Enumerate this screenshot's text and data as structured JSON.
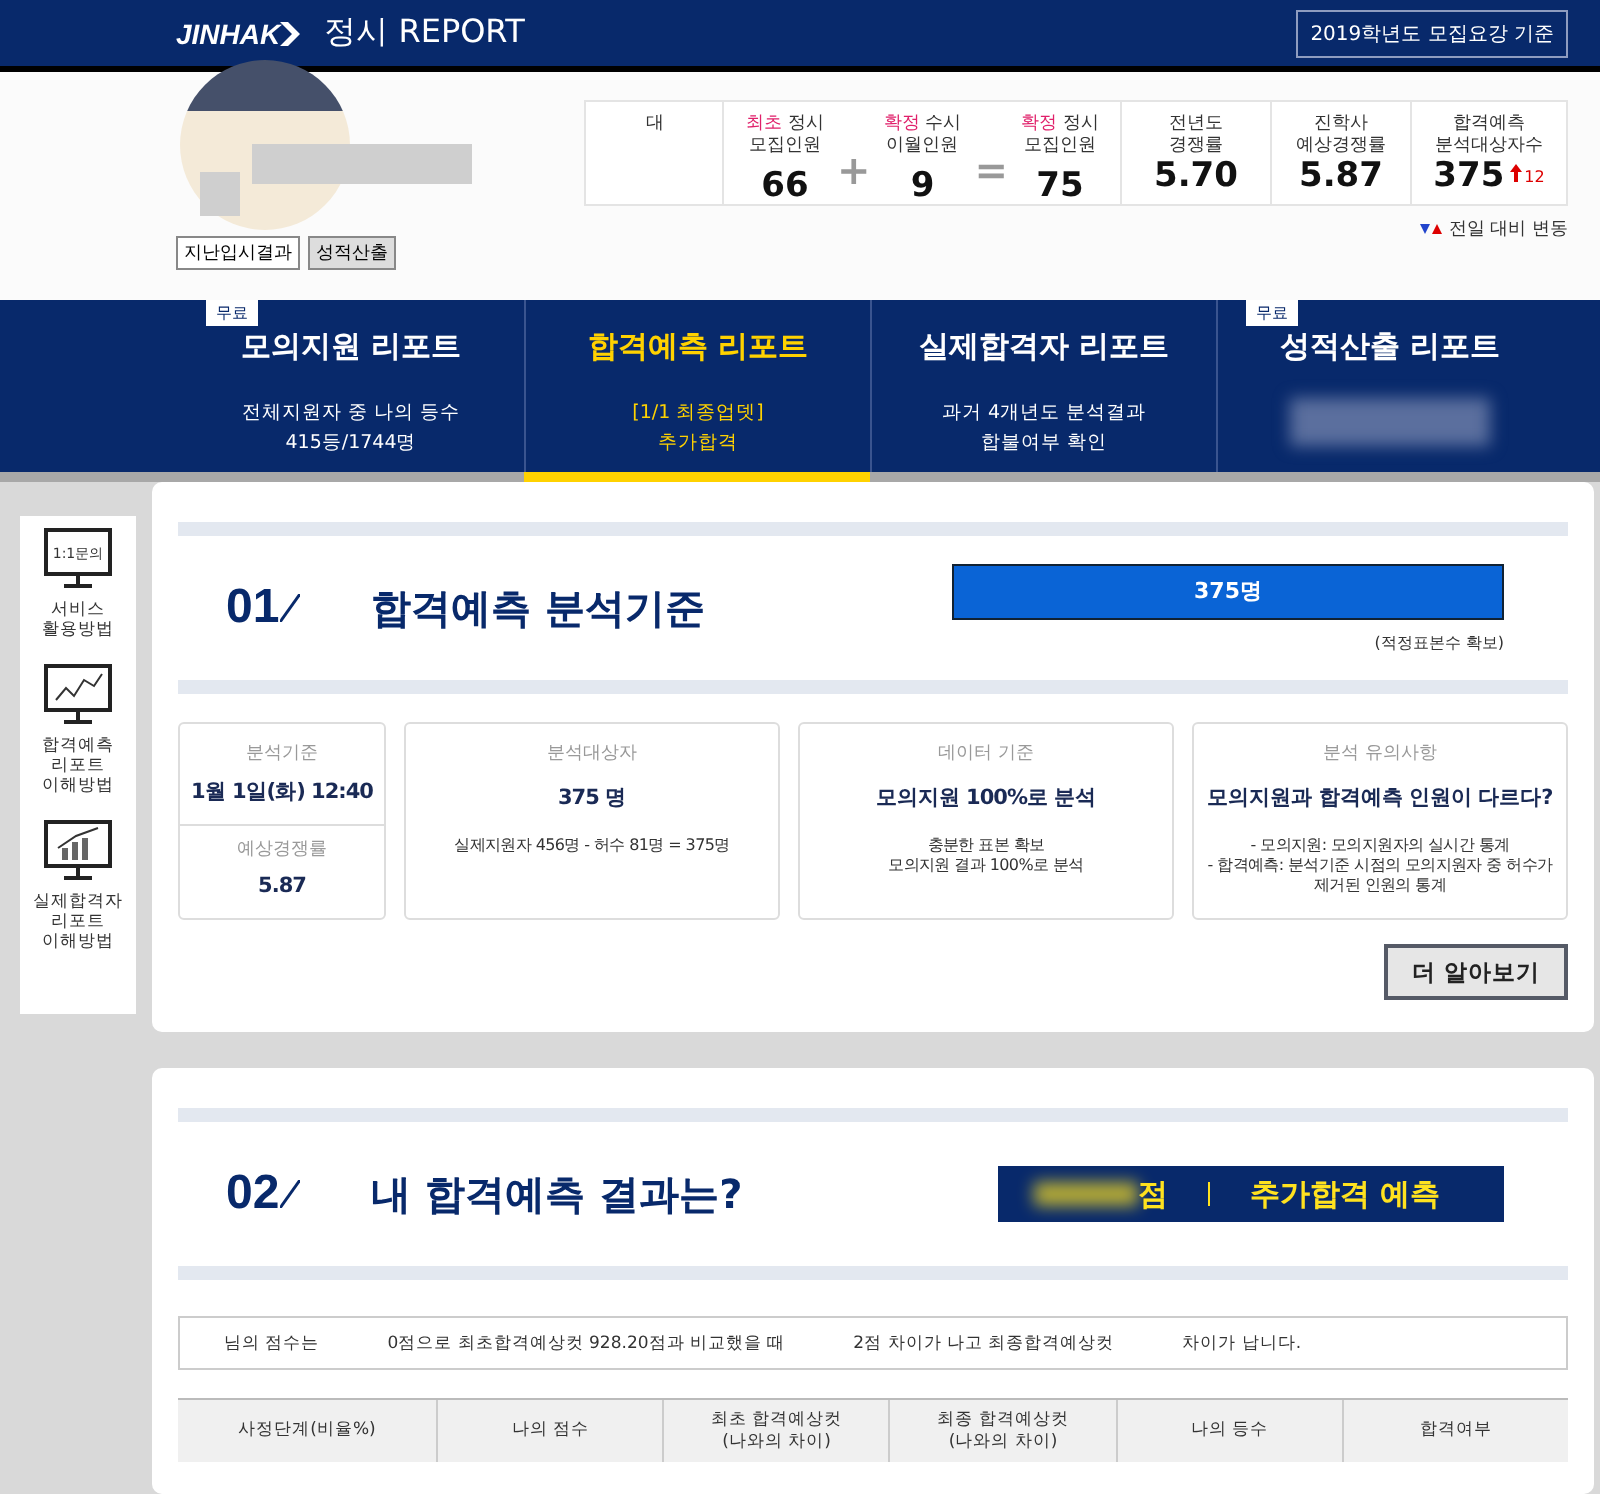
{
  "header": {
    "logo": "JINHAK",
    "title": "정시 REPORT",
    "badge": "2019학년도 모집요강 기준"
  },
  "profile": {
    "buttons": [
      {
        "label": "지난입시결과",
        "selected": false
      },
      {
        "label": "성적산출",
        "selected": true
      }
    ]
  },
  "stats": {
    "first_cell": "대",
    "quota": [
      {
        "kind": "count",
        "tag": "최초",
        "label": "정시",
        "sub": "모집인원",
        "value": "66"
      },
      {
        "kind": "operator",
        "value": "+"
      },
      {
        "kind": "count",
        "tag": "확정",
        "label": "수시",
        "sub": "이월인원",
        "value": "9"
      },
      {
        "kind": "operator",
        "value": "="
      },
      {
        "kind": "count",
        "tag": "확정",
        "label": "정시",
        "sub": "모집인원",
        "value": "75"
      }
    ],
    "metrics": [
      {
        "lines": [
          "전년도",
          "경쟁률"
        ],
        "value": "5.70"
      },
      {
        "lines": [
          "진학사",
          "예상경쟁률"
        ],
        "value": "5.87"
      },
      {
        "lines": [
          "합격예측",
          "분석대상자수"
        ],
        "value": "375",
        "change": "12"
      }
    ],
    "legend": "전일 대비 변동"
  },
  "tabs": [
    {
      "title": "모의지원 리포트",
      "lines": [
        "전체지원자 중 나의 등수",
        "415등/1744명"
      ],
      "badge": "무료",
      "selected": false
    },
    {
      "title": "합격예측 리포트",
      "lines": [
        "[1/1 최종업뎃]",
        "추가합격"
      ],
      "selected": true
    },
    {
      "title": "실제합격자 리포트",
      "lines": [
        "과거 4개년도 분석결과",
        "합불여부 확인"
      ],
      "selected": false
    },
    {
      "title": "성적산출 리포트",
      "badge": "무료",
      "selected": false
    }
  ],
  "sidebar": [
    {
      "kind": "text-screen",
      "screen_text": "1:1문의",
      "lines": [
        "서비스",
        "활용방법"
      ]
    },
    {
      "kind": "line-chart",
      "lines": [
        "합격예측",
        "리포트",
        "이해방법"
      ]
    },
    {
      "kind": "bar-chart",
      "lines": [
        "실제합격자",
        "리포트",
        "이해방법"
      ]
    }
  ],
  "section1": {
    "number": "01",
    "title": "합격예측 분석기준",
    "bar": "375명",
    "note": "(적정표본수 확보)",
    "first_card": [
      {
        "label": "분석기준",
        "value": "1월 1일(화) 12:40"
      },
      {
        "label": "예상경쟁률",
        "value": "5.87"
      }
    ],
    "cards": [
      {
        "label": "분석대상자",
        "value": "375 명",
        "lines": [
          "실제지원자 456명 - 허수 81명 = 375명"
        ]
      },
      {
        "label": "데이터 기준",
        "value": "모의지원 100%로 분석",
        "lines": [
          "충분한 표본 확보",
          "모의지원 결과 100%로 분석"
        ]
      },
      {
        "label": "분석 유의사항",
        "value": "모의지원과 합격예측 인원이 다르다?",
        "lines": [
          "- 모의지원: 모의지원자의 실시간 통계",
          "- 합격예측: 분석기준 시점의 모의지원자 중 허수가 제거된 인원의 통계"
        ]
      }
    ],
    "button": "더 알아보기"
  },
  "section2": {
    "number": "02",
    "title": "내 합격예측 결과는?",
    "score_unit": "점",
    "verdict": "추가합격 예측",
    "summary": [
      "님의 점수는",
      "0점으로 최초합격예상컷 928.20점과 비교했을 때",
      "2점 차이가 나고 최종합격예상컷",
      "차이가 납니다."
    ],
    "columns": [
      [
        "사정단계(비율%)"
      ],
      [
        "나의 점수"
      ],
      [
        "최초 합격예상컷",
        "(나와의 차이)"
      ],
      [
        "최종 합격예상컷",
        "(나와의 차이)"
      ],
      [
        "나의 등수"
      ],
      [
        "합격여부"
      ]
    ]
  }
}
